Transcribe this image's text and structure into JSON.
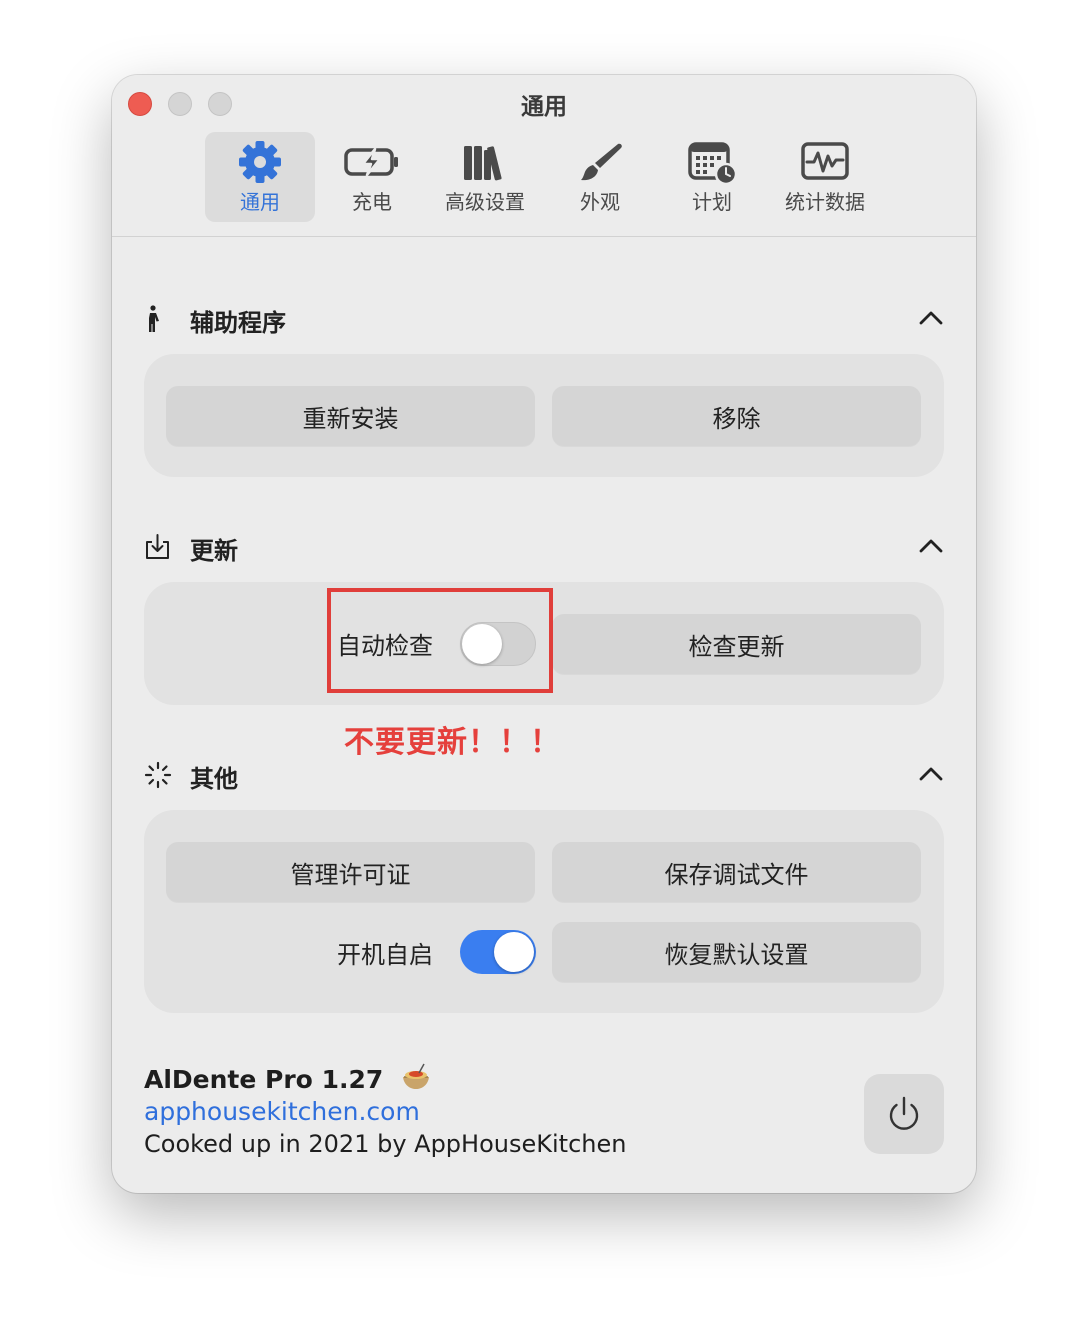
{
  "window": {
    "title": "通用"
  },
  "tabs": [
    {
      "label": "通用",
      "icon": "gear-icon",
      "active": true
    },
    {
      "label": "充电",
      "icon": "battery-charging-icon"
    },
    {
      "label": "高级设置",
      "icon": "books-icon"
    },
    {
      "label": "外观",
      "icon": "paintbrush-icon"
    },
    {
      "label": "计划",
      "icon": "calendar-clock-icon"
    },
    {
      "label": "统计数据",
      "icon": "waveform-monitor-icon"
    }
  ],
  "sections": {
    "helper": {
      "title": "辅助程序",
      "icon": "figure-icon",
      "buttons": {
        "reinstall": "重新安装",
        "remove": "移除"
      }
    },
    "update": {
      "title": "更新",
      "icon": "download-tray-icon",
      "auto_check_label": "自动检查",
      "auto_check_on": false,
      "check_button": "检查更新"
    },
    "other": {
      "title": "其他",
      "icon": "spinner-icon",
      "buttons": {
        "license": "管理许可证",
        "save_debug": "保存调试文件",
        "restore_defaults": "恢复默认设置"
      },
      "launch_label": "开机自启",
      "launch_on": true
    }
  },
  "annotation": {
    "warning": "不要更新！！！",
    "color": "#e5403c"
  },
  "footer": {
    "app_name": "AlDente Pro 1.27",
    "website": "apphousekitchen.com",
    "credit": "Cooked up in 2021 by AppHouseKitchen"
  },
  "colors": {
    "accent": "#3473d8",
    "toggle_on": "#3a7ef0",
    "close": "#ee5c52"
  }
}
